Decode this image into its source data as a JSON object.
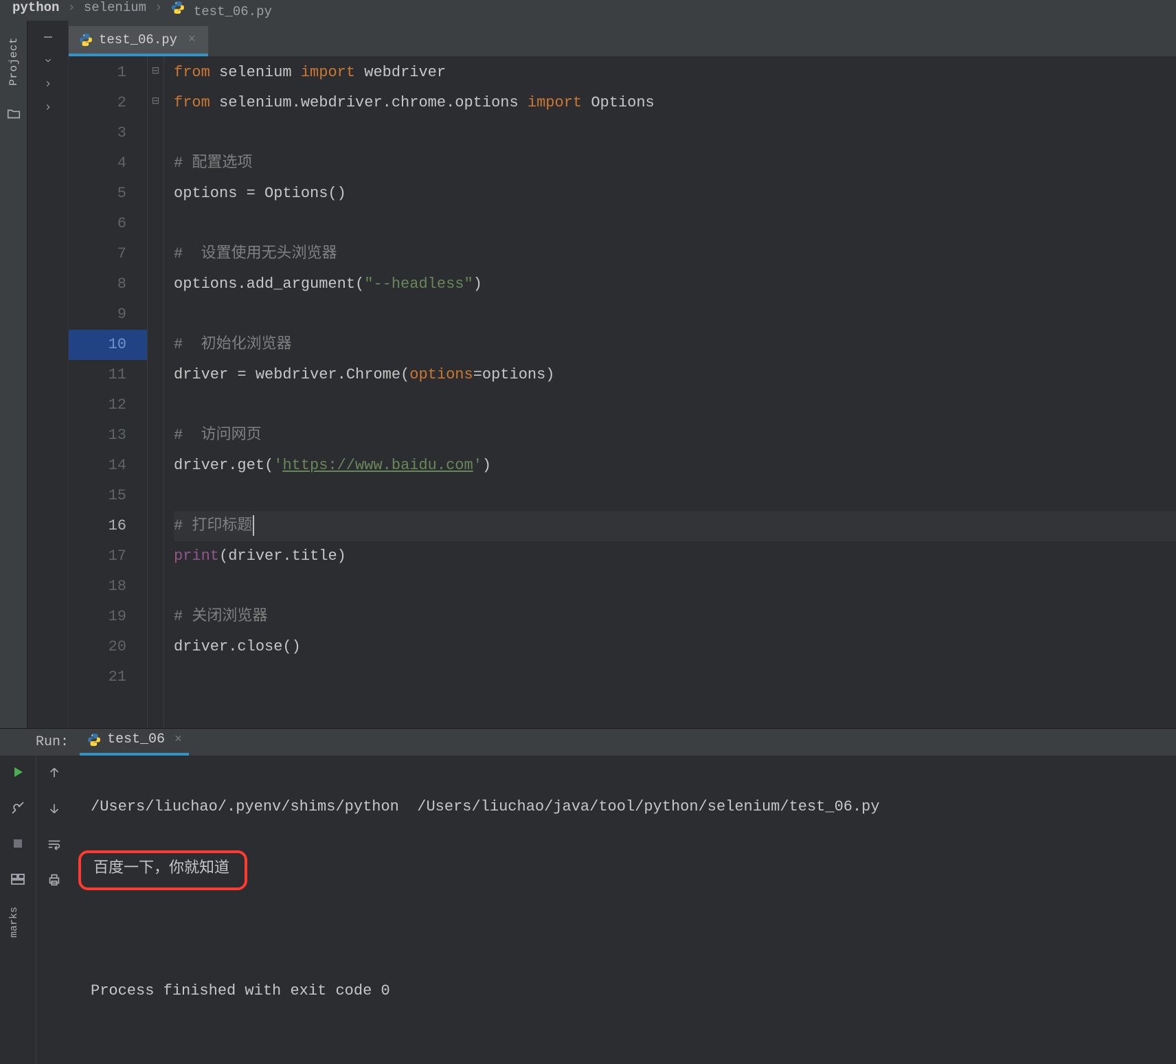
{
  "breadcrumb": {
    "items": [
      "python",
      "selenium",
      "test_06.py"
    ],
    "separator": "›"
  },
  "leftRail": {
    "projectLabel": "Project"
  },
  "editor": {
    "tab": {
      "filename": "test_06.py"
    },
    "lines": [
      {
        "n": 1,
        "tokens": [
          [
            "kw",
            "from"
          ],
          [
            "sp",
            " "
          ],
          [
            "id",
            "selenium"
          ],
          [
            "sp",
            " "
          ],
          [
            "kw",
            "import"
          ],
          [
            "sp",
            " "
          ],
          [
            "id",
            "webdriver"
          ]
        ]
      },
      {
        "n": 2,
        "tokens": [
          [
            "kw",
            "from"
          ],
          [
            "sp",
            " "
          ],
          [
            "id",
            "selenium.webdriver.chrome.options"
          ],
          [
            "sp",
            " "
          ],
          [
            "kw",
            "import"
          ],
          [
            "sp",
            " "
          ],
          [
            "id",
            "Options"
          ]
        ]
      },
      {
        "n": 3,
        "tokens": []
      },
      {
        "n": 4,
        "tokens": [
          [
            "cm",
            "# 配置选项"
          ]
        ]
      },
      {
        "n": 5,
        "tokens": [
          [
            "id",
            "options = Options()"
          ]
        ]
      },
      {
        "n": 6,
        "tokens": []
      },
      {
        "n": 7,
        "tokens": [
          [
            "cm",
            "#  设置使用无头浏览器"
          ]
        ]
      },
      {
        "n": 8,
        "tokens": [
          [
            "id",
            "options.add_argument("
          ],
          [
            "str",
            "\"--headless\""
          ],
          [
            "id",
            ")"
          ]
        ]
      },
      {
        "n": 9,
        "tokens": []
      },
      {
        "n": 10,
        "tokens": [
          [
            "cm",
            "#  初始化浏览器"
          ]
        ]
      },
      {
        "n": 11,
        "tokens": [
          [
            "id",
            "driver = webdriver.Chrome("
          ],
          [
            "named",
            "options"
          ],
          [
            "id",
            "=options)"
          ]
        ]
      },
      {
        "n": 12,
        "tokens": []
      },
      {
        "n": 13,
        "tokens": [
          [
            "cm",
            "#  访问网页"
          ]
        ]
      },
      {
        "n": 14,
        "tokens": [
          [
            "id",
            "driver.get("
          ],
          [
            "str",
            "'"
          ],
          [
            "url",
            "https://www.baidu.com"
          ],
          [
            "str",
            "'"
          ],
          [
            "id",
            ")"
          ]
        ]
      },
      {
        "n": 15,
        "tokens": []
      },
      {
        "n": 16,
        "current": true,
        "tokens": [
          [
            "cm",
            "# 打印标题"
          ],
          [
            "cursor",
            ""
          ]
        ]
      },
      {
        "n": 17,
        "tokens": [
          [
            "print",
            "print"
          ],
          [
            "id",
            "(driver.title)"
          ]
        ]
      },
      {
        "n": 18,
        "tokens": []
      },
      {
        "n": 19,
        "tokens": [
          [
            "cm",
            "# 关闭浏览器"
          ]
        ]
      },
      {
        "n": 20,
        "tokens": [
          [
            "id",
            "driver.close()"
          ]
        ]
      },
      {
        "n": 21,
        "tokens": []
      }
    ]
  },
  "run": {
    "label": "Run:",
    "tabName": "test_06",
    "console": {
      "cmd": "/Users/liuchao/.pyenv/shims/python  /Users/liuchao/java/tool/python/selenium/test_06.py",
      "output1": "百度一下，你就知道",
      "exit": "Process finished with exit code 0"
    }
  },
  "bottomRail": {
    "label": "marks"
  }
}
